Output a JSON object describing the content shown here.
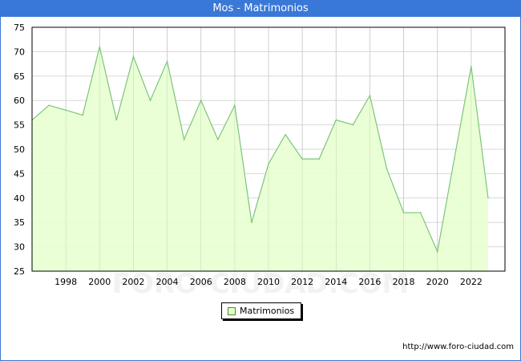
{
  "header": {
    "title": "Mos - Matrimonios"
  },
  "footer": {
    "url": "http://www.foro-ciudad.com"
  },
  "watermark": "FORO-CIUDAD.COM",
  "legend": {
    "label": "Matrimonios"
  },
  "colors": {
    "accent": "#3a78d8",
    "line": "#7dc47a",
    "fill": "#e8ffd0",
    "grid": "#d9d9d9"
  },
  "chart_data": {
    "type": "area",
    "title": "Mos - Matrimonios",
    "xlabel": "",
    "ylabel": "",
    "x": [
      1996,
      1997,
      1998,
      1999,
      2000,
      2001,
      2002,
      2003,
      2004,
      2005,
      2006,
      2007,
      2008,
      2009,
      2010,
      2011,
      2012,
      2013,
      2014,
      2015,
      2016,
      2017,
      2018,
      2019,
      2020,
      2021,
      2022,
      2023
    ],
    "series": [
      {
        "name": "Matrimonios",
        "values": [
          56,
          59,
          58,
          57,
          71,
          56,
          69,
          60,
          68,
          52,
          60,
          52,
          59,
          35,
          47,
          53,
          48,
          48,
          56,
          55,
          61,
          46,
          37,
          37,
          29,
          48,
          67,
          40
        ]
      }
    ],
    "x_ticks": [
      1998,
      2000,
      2002,
      2004,
      2006,
      2008,
      2010,
      2012,
      2014,
      2016,
      2018,
      2020,
      2022
    ],
    "y_ticks": [
      25,
      30,
      35,
      40,
      45,
      50,
      55,
      60,
      65,
      70,
      75
    ],
    "xlim": [
      1996,
      2024
    ],
    "ylim": [
      25,
      75
    ],
    "grid": true,
    "legend_position": "bottom"
  }
}
